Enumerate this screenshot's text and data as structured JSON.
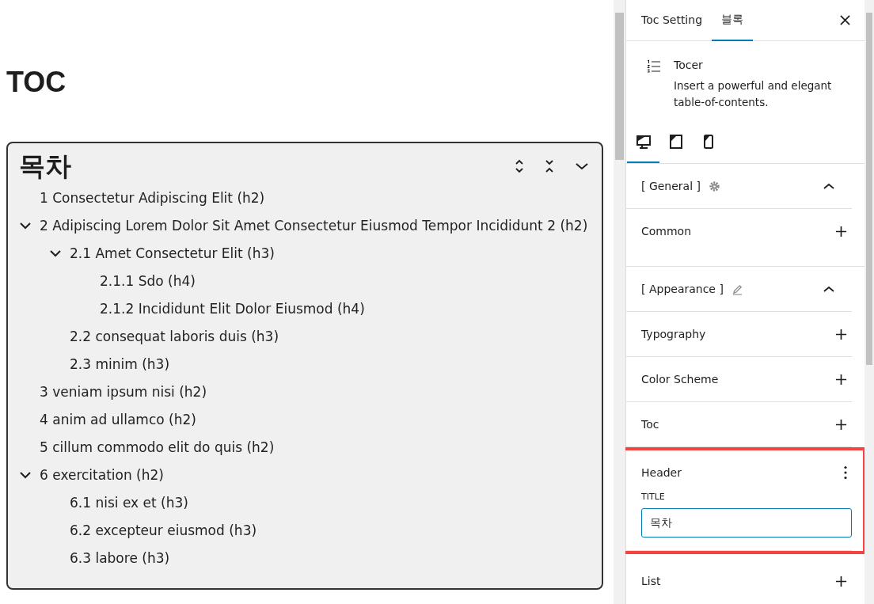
{
  "page": {
    "heading": "TOC"
  },
  "toc": {
    "title": "목차",
    "items": [
      {
        "label": "1 Consectetur Adipiscing Elit (h2)",
        "expanded": false
      },
      {
        "label": "2 Adipiscing Lorem Dolor Sit Amet Consectetur Eiusmod Tempor Incididunt 2 (h2)",
        "expanded": true,
        "children": [
          {
            "label": "2.1 Amet Consectetur Elit (h3)",
            "expanded": true,
            "children": [
              {
                "label": "2.1.1 Sdo (h4)",
                "expanded": false
              },
              {
                "label": "2.1.2 Incididunt Elit Dolor Eiusmod (h4)",
                "expanded": false
              }
            ]
          },
          {
            "label": "2.2 consequat laboris duis (h3)",
            "expanded": false
          },
          {
            "label": "2.3 minim (h3)",
            "expanded": false
          }
        ]
      },
      {
        "label": "3 veniam ipsum nisi (h2)",
        "expanded": false
      },
      {
        "label": "4 anim ad ullamco (h2)",
        "expanded": false
      },
      {
        "label": "5 cillum commodo elit do quis (h2)",
        "expanded": false
      },
      {
        "label": "6 exercitation (h2)",
        "expanded": true,
        "children": [
          {
            "label": "6.1 nisi ex et (h3)",
            "expanded": false
          },
          {
            "label": "6.2 excepteur eiusmod (h3)",
            "expanded": false
          },
          {
            "label": "6.3 labore (h3)",
            "expanded": false
          }
        ]
      }
    ]
  },
  "sidebar": {
    "tabs": [
      {
        "label": "Toc Setting",
        "selected": false
      },
      {
        "label": "블록",
        "selected": true
      }
    ],
    "block": {
      "name": "Tocer",
      "description": "Insert a powerful and elegant table-of-contents."
    },
    "device_tabs": [
      {
        "kind": "desktop",
        "selected": true
      },
      {
        "kind": "tablet",
        "selected": false
      },
      {
        "kind": "mobile",
        "selected": false
      }
    ],
    "groups": [
      {
        "kind": "settings",
        "label": "[ General ]",
        "expanded": true,
        "panels": [
          {
            "label": "Common",
            "expanded": false,
            "highlighted": false
          }
        ]
      },
      {
        "kind": "edit",
        "label": "[ Appearance ]",
        "expanded": true,
        "panels": [
          {
            "label": "Typography",
            "expanded": false,
            "highlighted": false
          },
          {
            "label": "Color Scheme",
            "expanded": false,
            "highlighted": false
          },
          {
            "label": "Toc",
            "expanded": false,
            "highlighted": false
          },
          {
            "label": "Header",
            "expanded": true,
            "highlighted": true,
            "field": {
              "label": "TITLE",
              "value": "목차"
            }
          },
          {
            "label": "List",
            "expanded": false,
            "highlighted": false
          }
        ]
      }
    ]
  }
}
